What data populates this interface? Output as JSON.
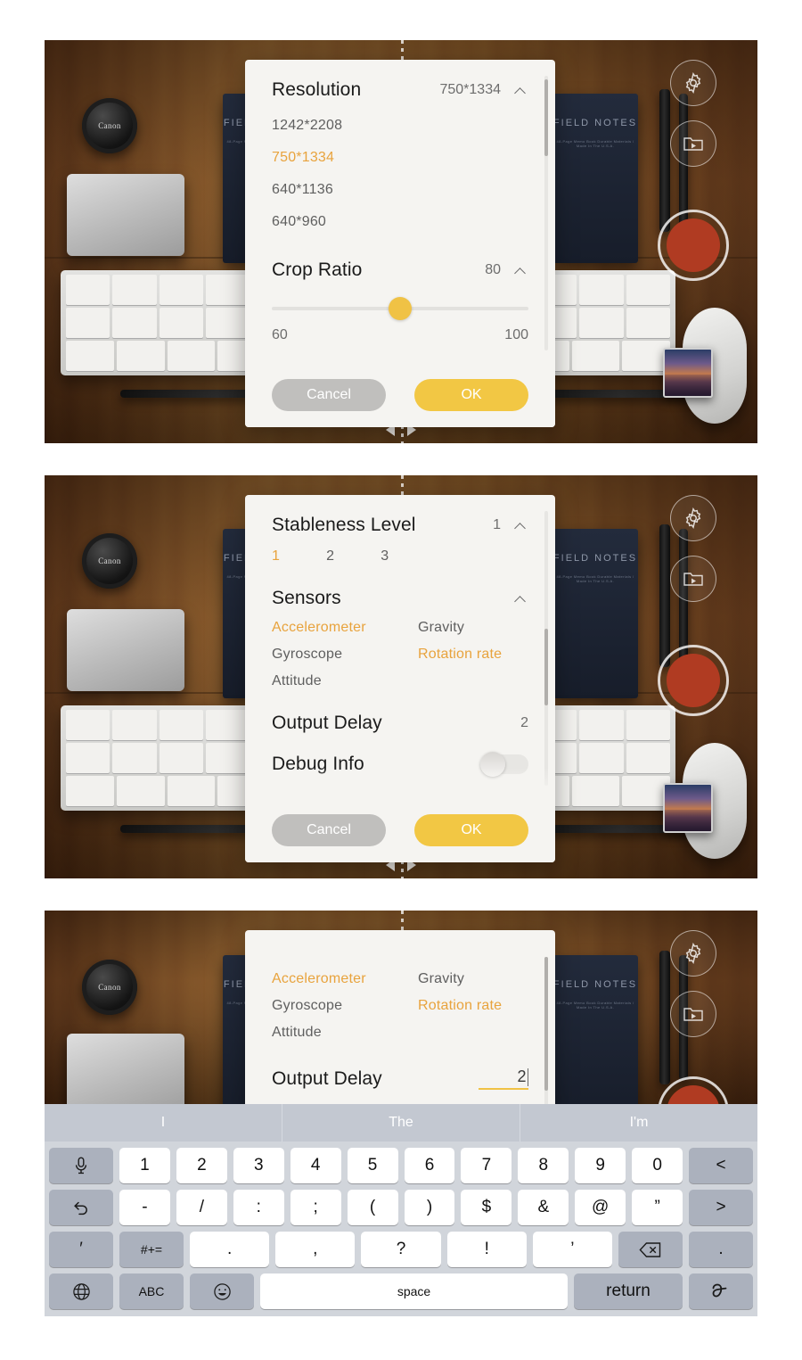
{
  "app": {
    "background_scene": "desk-photo-with-keyboard-notebooks-canon-lens-cap",
    "lens_cap_brand": "Canon",
    "notebook_title_line1": "FIELD",
    "notebook_title_line2": "NOTES",
    "notebook_subtitle": "48-Page Memo Book  Durable Materials / Made In The U.S.A."
  },
  "controls": {
    "gear": "gear-icon",
    "video": "video-folder-icon",
    "record": "record-button",
    "thumbnail": "last-capture-thumbnail"
  },
  "dialog1": {
    "resolution": {
      "title": "Resolution",
      "value": "750*1334",
      "options": [
        "1242*2208",
        "750*1334",
        "640*1136",
        "640*960"
      ],
      "selected": "750*1334"
    },
    "crop_ratio": {
      "title": "Crop Ratio",
      "value": "80",
      "min_label": "60",
      "max_label": "100",
      "min": 60,
      "max": 100,
      "current": 80
    },
    "cancel_label": "Cancel",
    "ok_label": "OK"
  },
  "dialog2": {
    "stableness": {
      "title": "Stableness Level",
      "value": "1",
      "options": [
        "1",
        "2",
        "3"
      ],
      "selected": "1"
    },
    "sensors": {
      "title": "Sensors",
      "options": [
        "Accelerometer",
        "Gravity",
        "Gyroscope",
        "Rotation rate",
        "Attitude"
      ],
      "selected": [
        "Accelerometer",
        "Rotation rate"
      ]
    },
    "output_delay": {
      "title": "Output Delay",
      "value": "2"
    },
    "debug_info": {
      "title": "Debug Info",
      "enabled": false
    },
    "cancel_label": "Cancel",
    "ok_label": "OK"
  },
  "dialog3": {
    "sensors": {
      "options": [
        "Accelerometer",
        "Gravity",
        "Gyroscope",
        "Rotation rate",
        "Attitude"
      ],
      "selected": [
        "Accelerometer",
        "Rotation rate"
      ]
    },
    "output_delay": {
      "title": "Output Delay",
      "value": "2",
      "editing": true
    }
  },
  "keyboard": {
    "suggestions": [
      "I",
      "The",
      "I'm"
    ],
    "row1": [
      "1",
      "2",
      "3",
      "4",
      "5",
      "6",
      "7",
      "8",
      "9",
      "0"
    ],
    "row1_left_icon": "microphone-icon",
    "row1_right_label": "<",
    "row2": [
      "-",
      "/",
      ":",
      ";",
      "(",
      ")",
      "$",
      "&",
      "@",
      "”"
    ],
    "row2_left_icon": "undo-icon",
    "row2_right_label": ">",
    "row3_left_label": "′",
    "row3_symbols_label": "#+=",
    "row3": [
      ".",
      ",",
      "?",
      "!",
      "’"
    ],
    "row3_backspace_icon": "backspace-icon",
    "row3_right_label": ".",
    "row4_globe_icon": "globe-icon",
    "row4_abc_label": "ABC",
    "row4_emoji_icon": "emoji-icon",
    "row4_space_label": "space",
    "row4_return_label": "return",
    "row4_handwriting_icon": "handwriting-icon"
  },
  "colors": {
    "accent_yellow": "#f2c744",
    "selected_text": "#e8a33d",
    "cancel_gray": "#c0bfbd",
    "dialog_bg": "#f5f4f1",
    "keyboard_bg": "#d1d5db",
    "record_red": "#b03b22"
  }
}
